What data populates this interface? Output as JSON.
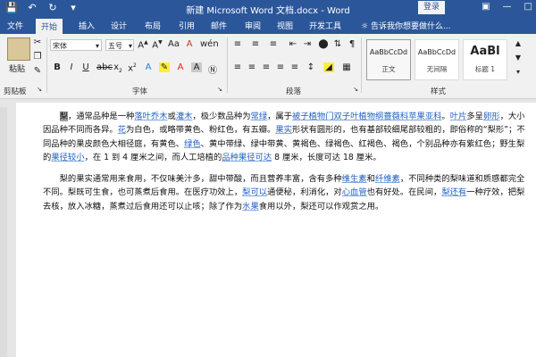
{
  "title": "新建 Microsoft Word 文档.docx - Word",
  "login_label": "登录",
  "tabs": [
    "文件",
    "开始",
    "插入",
    "设计",
    "布局",
    "引用",
    "邮件",
    "审阅",
    "视图",
    "开发工具"
  ],
  "tell_me": "告诉我你想要做什么...",
  "ribbon": {
    "paste_label": "粘贴",
    "clipboard_label": "剪贴板",
    "font_name": "宋体",
    "font_size": "五号",
    "font_group_label": "字体",
    "paragraph_group_label": "段落",
    "styles_group_label": "样式",
    "styles": [
      {
        "sample": "AaBbCcDd",
        "name": "正文"
      },
      {
        "sample": "AaBbCcDd",
        "name": "无间隔"
      },
      {
        "sample": "AaBl",
        "name": "标题 1"
      }
    ]
  },
  "document": {
    "p1": [
      {
        "t": "梨",
        "s": "hl"
      },
      {
        "t": "，通常品种是一种"
      },
      {
        "t": "落叶乔木",
        "s": "lnk"
      },
      {
        "t": "或"
      },
      {
        "t": "灌木",
        "s": "lnk"
      },
      {
        "t": "，极少数品种为"
      },
      {
        "t": "常绿",
        "s": "lnk"
      },
      {
        "t": "，属于"
      },
      {
        "t": "被子植物门",
        "s": "lnk"
      },
      {
        "t": "双子叶植物纲",
        "s": "lnk"
      },
      {
        "t": "蔷薇科苹果亚科",
        "s": "lnk"
      },
      {
        "t": "。"
      },
      {
        "t": "叶片",
        "s": "lnk"
      },
      {
        "t": "多呈"
      },
      {
        "t": "卵形",
        "s": "lnk"
      },
      {
        "t": "，大小因品种不同而各异。"
      },
      {
        "t": "花",
        "s": "lnk"
      },
      {
        "t": "为白色，或略带黄色、粉红色，有五瓣。"
      },
      {
        "t": "果实",
        "s": "lnk"
      },
      {
        "t": "形状有圆形的，也有基部较细尾部较粗的，即俗称的“梨形”；不同品种的果皮颜色大相径庭，有黄色、"
      },
      {
        "t": "绿色",
        "s": "lnk"
      },
      {
        "t": "、黄中带绿、绿中带黄、黄褐色、绿褐色、红褐色、褐色，个别品种亦有紫红色；野生梨的"
      },
      {
        "t": "果径较小",
        "s": "lnk"
      },
      {
        "t": "，在 1 到 4 厘米之间，而人工培植的"
      },
      {
        "t": "品种果径可达",
        "s": "lnk"
      },
      {
        "t": " 8 厘米，长度可达 18 厘米。"
      }
    ],
    "p2": [
      {
        "t": "梨的果实通常用来食用，不仅味美汁多，甜中带酸，而且营养丰富，含有多种"
      },
      {
        "t": "维生素",
        "s": "lnk"
      },
      {
        "t": "和"
      },
      {
        "t": "纤维素",
        "s": "lnk"
      },
      {
        "t": "，不同种类的梨味道和质感都完全不同。梨既可生食，也可蒸煮后食用。在医疗功效上，"
      },
      {
        "t": "梨可以",
        "s": "lnk"
      },
      {
        "t": "通便秘，利消化，对"
      },
      {
        "t": "心血管",
        "s": "lnk"
      },
      {
        "t": "也有好处。在民间，"
      },
      {
        "t": "梨还有",
        "s": "lnk"
      },
      {
        "t": "一种疗效，把梨去核，放入冰糖，蒸煮过后食用还可以止咳；除了作为"
      },
      {
        "t": "水果",
        "s": "lnk"
      },
      {
        "t": "食用以外，梨还可以作观赏之用。"
      }
    ]
  }
}
